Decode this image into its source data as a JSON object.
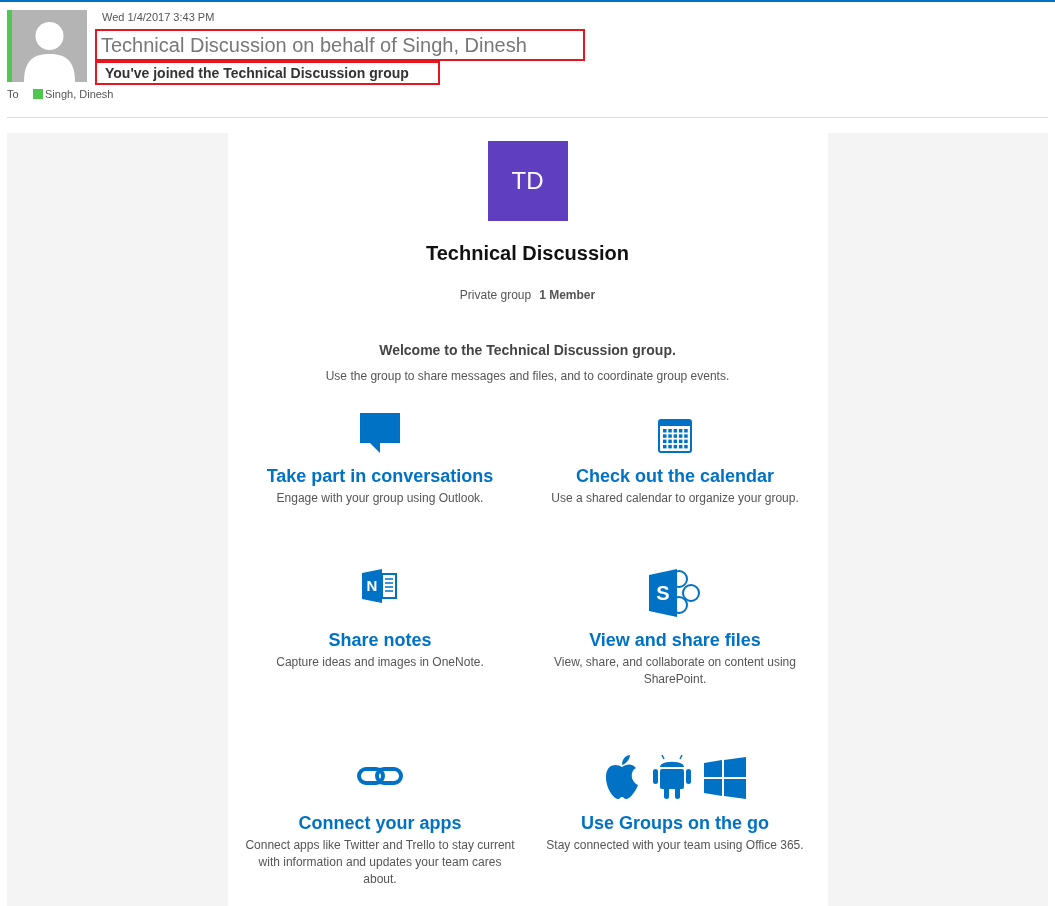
{
  "message": {
    "date": "Wed 1/4/2017 3:43 PM",
    "subject": "Technical Discussion on behalf of Singh, Dinesh",
    "subject_highlighted": true,
    "heading": "You've joined the Technical Discussion group",
    "heading_highlighted": true,
    "to_label": "To",
    "recipient": {
      "name": "Singh, Dinesh",
      "color": "#4fc64f"
    }
  },
  "group": {
    "initials": "TD",
    "name": "Technical Discussion",
    "privacy": "Private group",
    "members": "1 Member"
  },
  "welcome": {
    "title": "Welcome to the Technical Discussion group.",
    "text": "Use the group to share messages and files, and to coordinate group events."
  },
  "features": [
    {
      "kind": "chat",
      "title": "Take part in conversations",
      "text": "Engage with your group using Outlook."
    },
    {
      "kind": "calendar",
      "title": "Check out the calendar",
      "text": "Use a shared calendar to organize your group."
    },
    {
      "kind": "notes",
      "icon_letter": "N",
      "title": "Share notes",
      "text": "Capture ideas and images in OneNote."
    },
    {
      "kind": "files",
      "icon_letter": "S",
      "title": "View and share files",
      "text": "View, share, and collaborate on content using SharePoint."
    },
    {
      "kind": "link",
      "title": "Connect your apps",
      "text": "Connect apps like Twitter and Trello to stay current with information and updates your team cares about."
    },
    {
      "kind": "platforms",
      "title": "Use Groups on the go",
      "text": "Stay connected with your team using Office 365."
    }
  ]
}
